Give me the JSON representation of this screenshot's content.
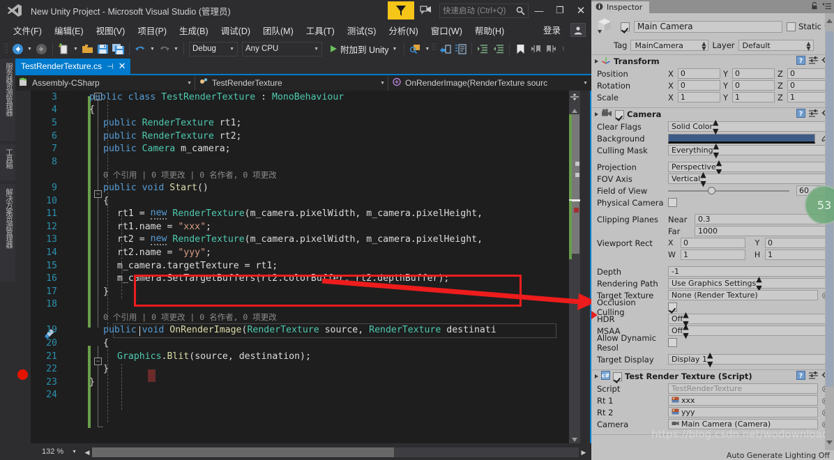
{
  "vs": {
    "title": "New Unity Project - Microsoft Visual Studio (管理员)",
    "quick_launch_placeholder": "快速启动 (Ctrl+Q)",
    "sign_in": "登录",
    "window_buttons": {
      "minimize": "—",
      "maximize": "❐",
      "close": "✕"
    },
    "menu": [
      {
        "label": "文件(F)"
      },
      {
        "label": "编辑(E)"
      },
      {
        "label": "视图(V)"
      },
      {
        "label": "项目(P)"
      },
      {
        "label": "生成(B)"
      },
      {
        "label": "调试(D)"
      },
      {
        "label": "团队(M)"
      },
      {
        "label": "工具(T)"
      },
      {
        "label": "测试(S)"
      },
      {
        "label": "分析(N)"
      },
      {
        "label": "窗口(W)"
      },
      {
        "label": "帮助(H)"
      }
    ],
    "toolbar": {
      "config": "Debug",
      "platform": "Any CPU",
      "run_label": "附加到 Unity",
      "icons": [
        "navigate-back-icon",
        "navigate-forward-icon",
        "new-item-icon",
        "open-file-icon",
        "save-icon",
        "save-all-icon",
        "undo-icon",
        "redo-icon",
        "start-debug-icon",
        "find-in-files-icon",
        "comment-icon",
        "uncomment-icon",
        "increase-indent-icon",
        "decrease-indent-icon",
        "bookmark-icon",
        "previous-bookmark-icon",
        "next-bookmark-icon"
      ]
    },
    "side_tabs": [
      "服务器资源管理器",
      "工具箱",
      "解决方案资源管理器"
    ],
    "document_tab": {
      "title": "TestRenderTexture.cs",
      "pin": "⊣",
      "close": "✕"
    },
    "navbar": {
      "project": "Assembly-CSharp",
      "type": "TestRenderTexture",
      "member": "OnRenderImage(RenderTexture sourc"
    },
    "status": {
      "zoom": "132 %"
    },
    "code": {
      "first_line": 3,
      "lines": [
        {
          "n": 3,
          "indent": 0,
          "tokens": [
            {
              "t": "public ",
              "c": "kw"
            },
            {
              "t": "class ",
              "c": "kw"
            },
            {
              "t": "TestRenderTexture ",
              "c": "ty"
            },
            {
              "t": ": ",
              "c": "pl"
            },
            {
              "t": "MonoBehaviour",
              "c": "ty"
            }
          ]
        },
        {
          "n": 4,
          "indent": 0,
          "tokens": [
            {
              "t": "{",
              "c": "pl"
            }
          ]
        },
        {
          "n": 5,
          "indent": 1,
          "tokens": [
            {
              "t": "public ",
              "c": "kw"
            },
            {
              "t": "RenderTexture ",
              "c": "ty"
            },
            {
              "t": "rt1;",
              "c": "id"
            }
          ]
        },
        {
          "n": 6,
          "indent": 1,
          "tokens": [
            {
              "t": "public ",
              "c": "kw"
            },
            {
              "t": "RenderTexture ",
              "c": "ty"
            },
            {
              "t": "rt2;",
              "c": "id"
            }
          ]
        },
        {
          "n": 7,
          "indent": 1,
          "tokens": [
            {
              "t": "public ",
              "c": "kw"
            },
            {
              "t": "Camera ",
              "c": "ty"
            },
            {
              "t": "m_camera;",
              "c": "id"
            }
          ]
        },
        {
          "n": 8,
          "indent": 1,
          "tokens": []
        },
        {
          "n": "",
          "indent": 1,
          "codelens": "0 个引用 | 0 项更改 | 0 名作者, 0 项更改"
        },
        {
          "n": 9,
          "indent": 1,
          "tokens": [
            {
              "t": "public ",
              "c": "kw"
            },
            {
              "t": "void ",
              "c": "kw"
            },
            {
              "t": "Start",
              "c": "ty2"
            },
            {
              "t": "()",
              "c": "pl"
            }
          ]
        },
        {
          "n": 10,
          "indent": 1,
          "tokens": [
            {
              "t": "{",
              "c": "pl"
            }
          ]
        },
        {
          "n": 11,
          "indent": 2,
          "tokens": [
            {
              "t": "rt1 = ",
              "c": "id"
            },
            {
              "t": "new",
              "c": "newkw"
            },
            {
              "t": " ",
              "c": "id"
            },
            {
              "t": "RenderTexture",
              "c": "ty"
            },
            {
              "t": "(m_camera.pixelWidth, m_camera.pixelHeight,",
              "c": "id"
            }
          ]
        },
        {
          "n": 12,
          "indent": 2,
          "tokens": [
            {
              "t": "rt1.name = ",
              "c": "id"
            },
            {
              "t": "\"xxx\"",
              "c": "st"
            },
            {
              "t": ";",
              "c": "id"
            }
          ]
        },
        {
          "n": 13,
          "indent": 2,
          "tokens": [
            {
              "t": "rt2 = ",
              "c": "id"
            },
            {
              "t": "new",
              "c": "newkw"
            },
            {
              "t": " ",
              "c": "id"
            },
            {
              "t": "RenderTexture",
              "c": "ty"
            },
            {
              "t": "(m_camera.pixelWidth, m_camera.pixelHeight,",
              "c": "id"
            }
          ]
        },
        {
          "n": 14,
          "indent": 2,
          "tokens": [
            {
              "t": "rt2.name = ",
              "c": "id"
            },
            {
              "t": "\"yyy\"",
              "c": "st"
            },
            {
              "t": ";",
              "c": "id"
            }
          ]
        },
        {
          "n": 15,
          "indent": 2,
          "tokens": [
            {
              "t": "m_camera.targetTexture = rt1;",
              "c": "id"
            }
          ]
        },
        {
          "n": 16,
          "indent": 2,
          "tokens": [
            {
              "t": "m_camera.SetTargetBuffers(rt2.colorBuffer, rt2.depthBuffer);",
              "c": "id"
            }
          ]
        },
        {
          "n": 17,
          "indent": 1,
          "tokens": [
            {
              "t": "}",
              "c": "pl"
            }
          ]
        },
        {
          "n": 18,
          "indent": 1,
          "tokens": []
        },
        {
          "n": "",
          "indent": 1,
          "codelens": "0 个引用 | 0 项更改 | 0 名作者, 0 项更改"
        },
        {
          "n": 19,
          "indent": 1,
          "tokens": [
            {
              "t": "public ",
              "c": "kw"
            },
            {
              "t": "void ",
              "c": "kw"
            },
            {
              "t": "OnRenderImage",
              "c": "ty2"
            },
            {
              "t": "(",
              "c": "pl"
            },
            {
              "t": "RenderTexture ",
              "c": "ty"
            },
            {
              "t": "source, ",
              "c": "id"
            },
            {
              "t": "RenderTexture ",
              "c": "ty"
            },
            {
              "t": "destinati",
              "c": "id"
            }
          ]
        },
        {
          "n": 20,
          "indent": 1,
          "tokens": [
            {
              "t": "{",
              "c": "hl"
            }
          ]
        },
        {
          "n": 21,
          "indent": 2,
          "tokens": [
            {
              "t": "Graphics",
              "c": "ty"
            },
            {
              "t": ".",
              "c": "pl"
            },
            {
              "t": "Blit",
              "c": "ty2"
            },
            {
              "t": "(source, destination);",
              "c": "id"
            }
          ]
        },
        {
          "n": 22,
          "indent": 1,
          "tokens": [
            {
              "t": "}",
              "c": "pl"
            }
          ]
        },
        {
          "n": 23,
          "indent": 0,
          "tokens": [
            {
              "t": "}",
              "c": "pl"
            }
          ]
        },
        {
          "n": 24,
          "indent": 0,
          "tokens": []
        }
      ]
    }
  },
  "inspector": {
    "tab_label": "Inspector",
    "tab_icon": "info-icon",
    "lock_icon": "lock-icon",
    "menu_icon": "hamburger-menu-icon",
    "object": {
      "enabled": true,
      "name": "Main Camera",
      "static_label": "Static",
      "static_checked": false,
      "tag_label": "Tag",
      "tag_value": "MainCamera",
      "layer_label": "Layer",
      "layer_value": "Default"
    },
    "components": [
      {
        "title": "Transform",
        "icon": "transform-axis-icon",
        "enabled": null,
        "rows": [
          {
            "type": "vec3",
            "name": "Position",
            "x": "0",
            "y": "0",
            "z": "0"
          },
          {
            "type": "vec3",
            "name": "Rotation",
            "x": "0",
            "y": "0",
            "z": "0"
          },
          {
            "type": "vec3",
            "name": "Scale",
            "x": "1",
            "y": "1",
            "z": "1"
          }
        ]
      },
      {
        "title": "Camera",
        "icon": "camera-icon",
        "enabled": true,
        "rows": [
          {
            "type": "dropdown",
            "name": "Clear Flags",
            "value": "Solid Color"
          },
          {
            "type": "color",
            "name": "Background",
            "value": "#3c5a86",
            "picker": "eyedropper-icon"
          },
          {
            "type": "dropdown",
            "name": "Culling Mask",
            "value": "Everything"
          },
          {
            "type": "spacer"
          },
          {
            "type": "dropdown",
            "name": "Projection",
            "value": "Perspective"
          },
          {
            "type": "dropdown",
            "name": "FOV Axis",
            "value": "Vertical"
          },
          {
            "type": "slider",
            "name": "Field of View",
            "value": "60"
          },
          {
            "type": "checkbox",
            "name": "Physical Camera",
            "checked": false
          },
          {
            "type": "spacer"
          },
          {
            "type": "pair",
            "name": "Clipping Planes",
            "k1": "Near",
            "v1": "0.3"
          },
          {
            "type": "pair",
            "name": "",
            "k1": "Far",
            "v1": "1000"
          },
          {
            "type": "pair2",
            "name": "Viewport Rect",
            "k1": "X",
            "v1": "0",
            "k2": "Y",
            "v2": "0"
          },
          {
            "type": "pair2",
            "name": "",
            "k1": "W",
            "v1": "1",
            "k2": "H",
            "v2": "1"
          },
          {
            "type": "spacer"
          },
          {
            "type": "text",
            "name": "Depth",
            "value": "-1"
          },
          {
            "type": "dropdown",
            "name": "Rendering Path",
            "value": "Use Graphics Settings"
          },
          {
            "type": "object",
            "name": "Target Texture",
            "value": "None (Render Texture)",
            "marked": true
          },
          {
            "type": "checkbox",
            "name": "Occlusion Culling",
            "checked": true
          },
          {
            "type": "dropdown",
            "name": "HDR",
            "value": "Off"
          },
          {
            "type": "dropdown",
            "name": "MSAA",
            "value": "Off"
          },
          {
            "type": "checkbox",
            "name": "Allow Dynamic Resol",
            "checked": false
          },
          {
            "type": "spacer"
          },
          {
            "type": "dropdown",
            "name": "Target Display",
            "value": "Display 1"
          }
        ]
      },
      {
        "title": "Test Render Texture (Script)",
        "icon": "csharp-script-icon",
        "enabled": true,
        "rows": [
          {
            "type": "object",
            "name": "Script",
            "value": "TestRenderTexture",
            "dim": true
          },
          {
            "type": "object",
            "name": "Rt 1",
            "value": "xxx",
            "thumb": "render-texture-icon"
          },
          {
            "type": "object",
            "name": "Rt 2",
            "value": "yyy",
            "thumb": "render-texture-icon"
          },
          {
            "type": "object",
            "name": "Camera",
            "value": "Main Camera (Camera)",
            "thumb": "camera-small-icon"
          }
        ]
      }
    ],
    "watermark": "https://blog.csdn.net/wodownload2",
    "footer_note": "Auto Generate Lighting Off",
    "badge": "53"
  }
}
